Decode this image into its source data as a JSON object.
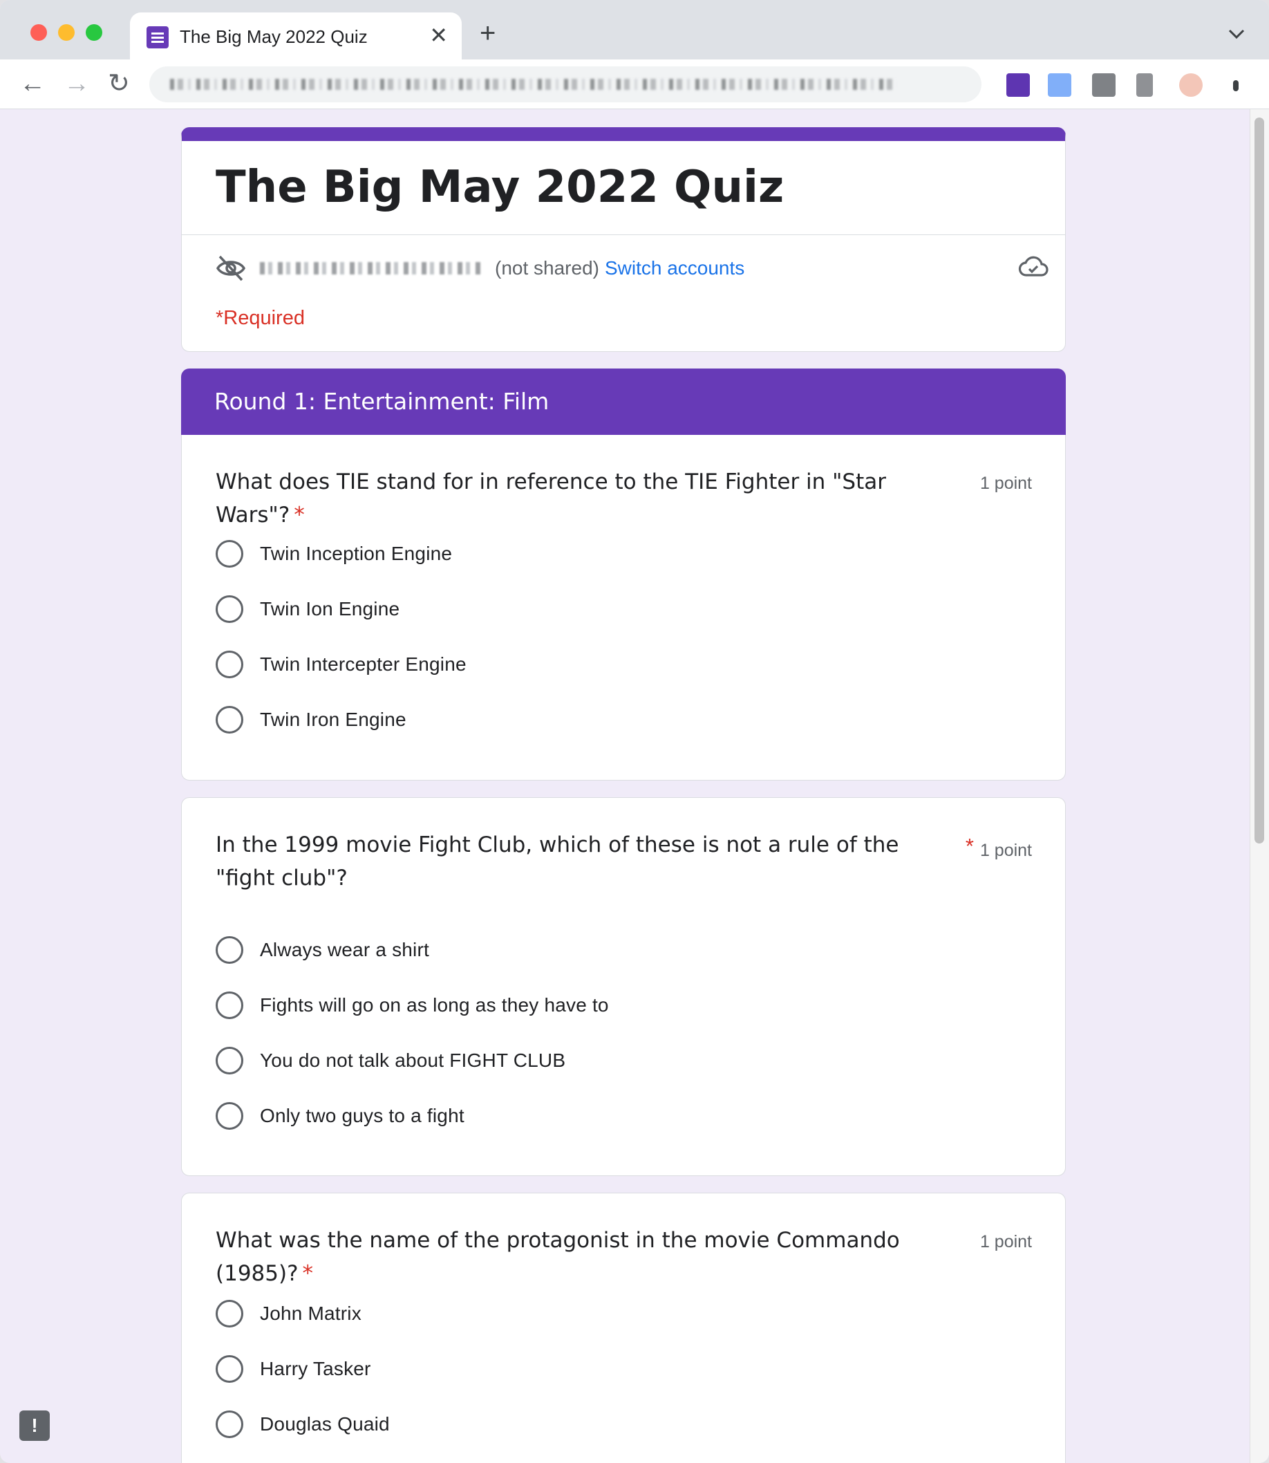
{
  "browser": {
    "tab_title": "The Big May 2022 Quiz",
    "tab_close": "✕",
    "new_tab": "+",
    "tab_list": "⌄",
    "back": "←",
    "forward": "→",
    "reload": "↻"
  },
  "form": {
    "title": "The Big May 2022 Quiz",
    "not_shared": "(not shared)",
    "switch_accounts": "Switch accounts",
    "required_note": "*Required",
    "accent_color": "#673ab7"
  },
  "section": {
    "title": "Round 1: Entertainment: Film"
  },
  "questions": [
    {
      "text": "What does TIE stand for in reference to the TIE Fighter in \"Star Wars\"?",
      "required": "*",
      "points": "1 point",
      "options": [
        "Twin Inception Engine",
        "Twin Ion Engine",
        "Twin Intercepter Engine",
        "Twin Iron Engine"
      ]
    },
    {
      "text": "In the 1999 movie Fight Club, which of these is not a rule of the \"fight club\"?",
      "required": "*",
      "points": "1 point",
      "options": [
        "Always wear a shirt",
        "Fights will go on as long as they have to",
        "You do not talk about FIGHT CLUB",
        "Only two guys to a fight"
      ]
    },
    {
      "text": "What was the name of the protagonist in the movie Commando (1985)?",
      "required": "*",
      "points": "1 point",
      "options": [
        "John Matrix",
        "Harry Tasker",
        "Douglas Quaid"
      ]
    }
  ],
  "feedback_label": "!"
}
